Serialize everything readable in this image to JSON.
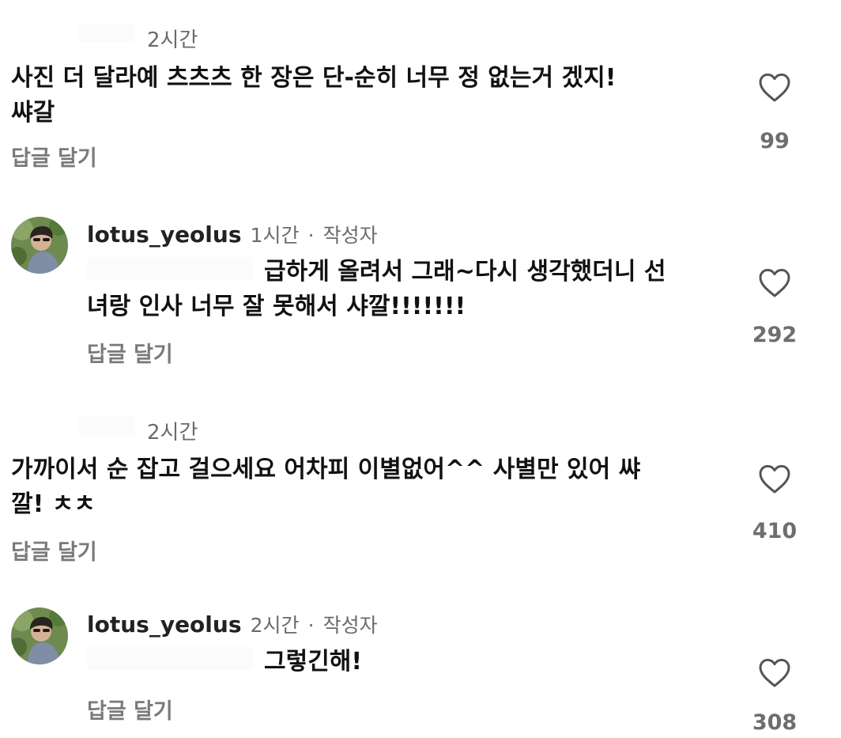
{
  "comments": [
    {
      "time": "2시간",
      "lines": [
        "사진 더 달라예 츠츠츠 한 장은 단-순히 너무 정 없는거 겠지!",
        "쌰갈"
      ],
      "reply_label": "답글 달기",
      "likes": "99"
    },
    {
      "username": "lotus_yeolus",
      "time": "1시간",
      "separator": "·",
      "author_badge": "작성자",
      "lines": [
        "급하게 올려서 그래~다시 생각했더니 선",
        "녀랑 인사 너무 잘 못해서 샤깔!!!!!!!"
      ],
      "reply_label": "답글 달기",
      "likes": "292"
    },
    {
      "time": "2시간",
      "lines": [
        "가까이서 순 잡고 걸으세요 어차피 이별없어^^ 사별만 있어 쌰",
        "깔! ㅊㅊ"
      ],
      "reply_label": "답글 달기",
      "likes": "410"
    },
    {
      "username": "lotus_yeolus",
      "time": "2시간",
      "separator": "·",
      "author_badge": "작성자",
      "lines": [
        "그렇긴해!"
      ],
      "reply_label": "답글 달기",
      "likes": "308"
    }
  ],
  "icons": {
    "like": "heart-outline-icon",
    "avatar": "profile-avatar"
  },
  "colors": {
    "text": "#111111",
    "secondary": "#6b6b6b",
    "like_count": "#6e6e6e",
    "heart_stroke": "#555555"
  }
}
